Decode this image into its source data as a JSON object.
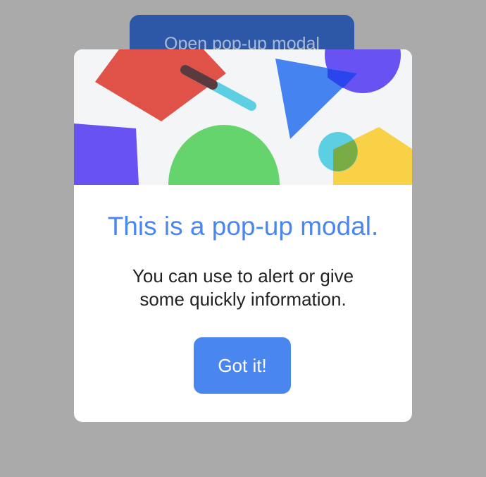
{
  "background_button": {
    "label": "Open pop-up modal"
  },
  "modal": {
    "illustration": "abstract-shapes-illustration",
    "title": "This is a pop-up modal.",
    "message_line1": "You can use to alert or give",
    "message_line2": "some quickly information.",
    "confirm_label": "Got it!"
  },
  "colors": {
    "backdrop": "#aaaaaa",
    "accent": "#4a86f0",
    "open_button": "#2d58a8",
    "modal_background": "#ffffff",
    "hero_background": "#f4f5f7",
    "shape_red": "#e05148",
    "shape_blue": "#4583f0",
    "shape_purple": "#6952f2",
    "shape_green": "#66d46c",
    "shape_cyan": "#5cd0e2",
    "shape_yellow": "#f8d147"
  }
}
